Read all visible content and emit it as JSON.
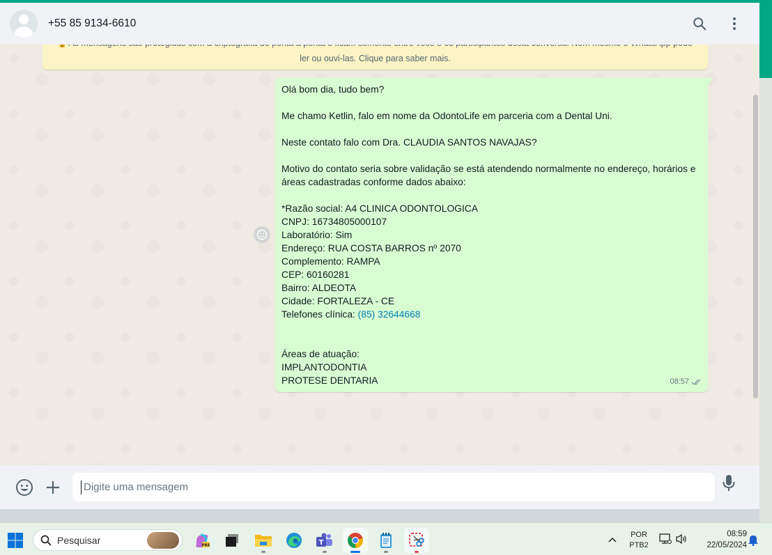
{
  "header": {
    "contact_name": "+55 85 9134-6610",
    "icons": [
      "search-icon",
      "menu-icon"
    ]
  },
  "chat": {
    "encryption_notice": "As mensagens são protegidas com a criptografia de ponta a ponta e ficam somente entre você e os participantes desta conversa. Nem mesmo o WhatsApp pode ler ou ouvi-las. Clique para saber mais.",
    "message": {
      "text_main": "Olá bom dia, tudo bem?\n\nMe chamo Ketlin, falo em nome da OdontoLife em parceria com a Dental Uni.\n\nNeste contato falo com Dra. CLAUDIA SANTOS NAVAJAS?\n\nMotivo do contato seria sobre validação se está atendendo normalmente no endereço, horários e áreas cadastradas conforme dados abaixo:\n\n*Razão social: A4 CLINICA ODONTOLOGICA\nCNPJ: 16734805000107\nLaboratório: Sim\nEndereço: RUA COSTA BARROS nº 2070\nComplemento: RAMPA\nCEP: 60160281\nBairro: ALDEOTA\nCidade: FORTALEZA - CE\n",
      "phone_label": "Telefones clínica: ",
      "phone_link": "(85) 32644668",
      "text_tail": "\n\n\nÁreas de atuação:\nIMPLANTODONTIA\nPROTESE DENTARIA",
      "time": "08:57",
      "status": "double-check-icon"
    }
  },
  "composer": {
    "placeholder": "Digite uma mensagem",
    "icons": [
      "emoji-icon",
      "plus-icon",
      "mic-icon"
    ]
  },
  "taskbar": {
    "search_label": "Pesquisar",
    "apps": [
      "copilot-icon",
      "task-view-icon",
      "file-explorer-icon",
      "edge-icon",
      "teams-icon",
      "chrome-icon",
      "notepad-icon",
      "snipping-tool-icon"
    ],
    "lang_line1": "POR",
    "lang_line2": "PTB2",
    "time": "08:59",
    "date": "22/05/2024"
  },
  "colors": {
    "accent": "#00a884",
    "bubble_out": "#d9fdd3",
    "banner": "#fdf4c5",
    "link": "#027eb5"
  }
}
